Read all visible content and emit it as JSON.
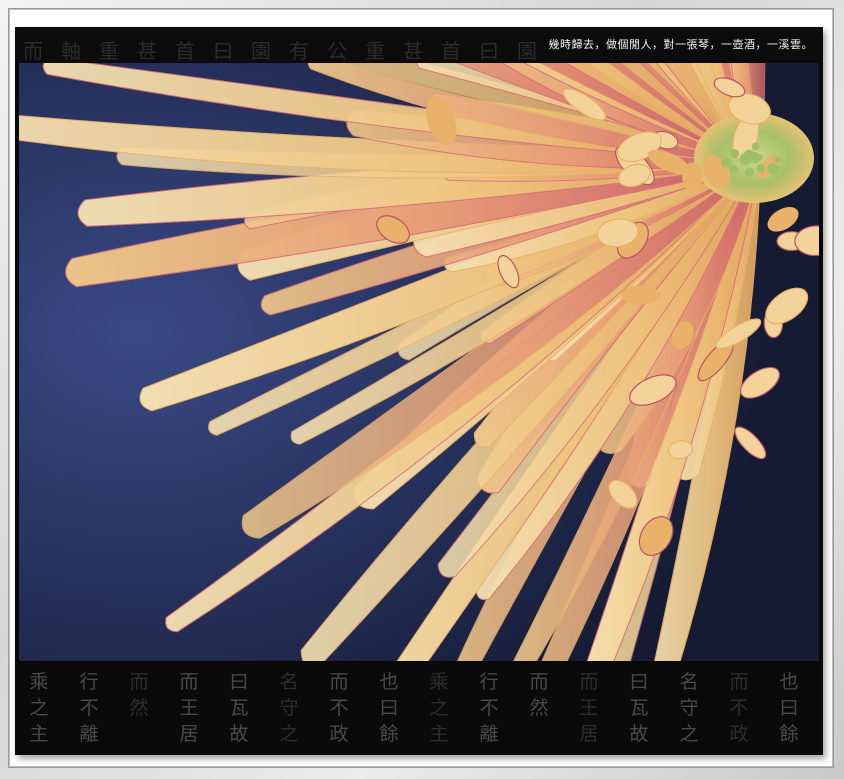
{
  "poem_caption": "幾時歸去，做個閒人，對一張琴，一壺酒，一溪雲。",
  "top_band_chars": [
    "而",
    "軸",
    "重",
    "甚",
    "首",
    "曰",
    "園",
    "有",
    "公",
    "重",
    "甚",
    "首",
    "曰",
    "園"
  ],
  "bottom_band_columns": [
    [
      "乘",
      "之",
      "主"
    ],
    [
      "行",
      "不",
      "離"
    ],
    [
      "而",
      "然"
    ],
    [
      "而",
      "王",
      "居"
    ],
    [
      "曰",
      "瓦",
      "故"
    ],
    [
      "名",
      "守",
      "之"
    ],
    [
      "而",
      "不",
      "政"
    ],
    [
      "也",
      "曰",
      "餘"
    ],
    [
      "乘",
      "之",
      "主"
    ],
    [
      "行",
      "不",
      "離"
    ],
    [
      "而",
      "然"
    ],
    [
      "而",
      "王",
      "居"
    ],
    [
      "曰",
      "瓦",
      "故"
    ],
    [
      "名",
      "守",
      "之"
    ],
    [
      "而",
      "不",
      "政"
    ],
    [
      "也",
      "曰",
      "餘"
    ]
  ],
  "photo": {
    "subject": "chrysanthemum-flower",
    "colors": {
      "petal_light": "#f3d39a",
      "petal_mid": "#e8b26a",
      "petal_pink": "#d9707a",
      "petal_deep": "#b85365",
      "center_green": "#9fbf6a",
      "background_blue": "#2a3566"
    }
  }
}
